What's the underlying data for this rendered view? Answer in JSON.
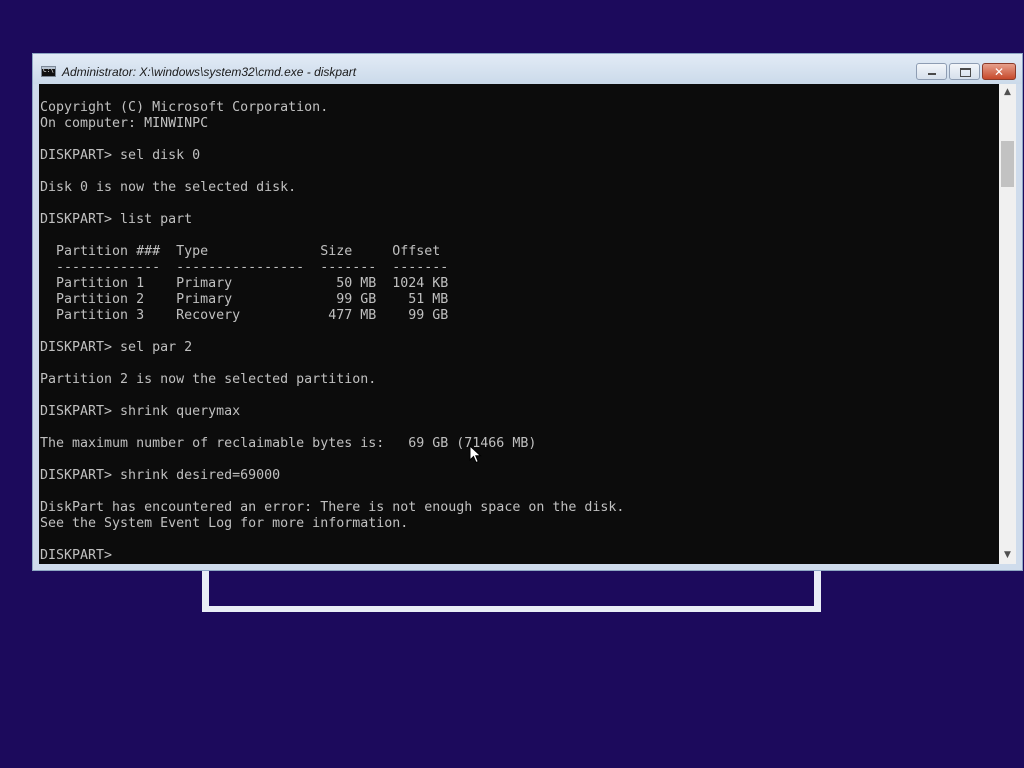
{
  "window": {
    "title": "Administrator: X:\\windows\\system32\\cmd.exe - diskpart",
    "icon": "cmd-icon",
    "icon_label": "C:\\",
    "controls": {
      "minimize": "minimize-icon",
      "maximize": "maximize-icon",
      "close": "close-icon",
      "close_glyph": "✕"
    }
  },
  "console": {
    "lines": [
      "Copyright (C) Microsoft Corporation.",
      "On computer: MINWINPC",
      "",
      "DISKPART> sel disk 0",
      "",
      "Disk 0 is now the selected disk.",
      "",
      "DISKPART> list part",
      "",
      "  Partition ###  Type              Size     Offset",
      "  -------------  ----------------  -------  -------",
      "  Partition 1    Primary             50 MB  1024 KB",
      "  Partition 2    Primary             99 GB    51 MB",
      "  Partition 3    Recovery           477 MB    99 GB",
      "",
      "DISKPART> sel par 2",
      "",
      "Partition 2 is now the selected partition.",
      "",
      "DISKPART> shrink querymax",
      "",
      "The maximum number of reclaimable bytes is:   69 GB (71466 MB)",
      "",
      "DISKPART> shrink desired=69000",
      "",
      "DiskPart has encountered an error: There is not enough space on the disk.",
      "See the System Event Log for more information.",
      "",
      "DISKPART> "
    ]
  },
  "scrollbar": {
    "up_arrow": "▲",
    "down_arrow": "▼"
  },
  "colors": {
    "desktop": "#1c0a5c",
    "console_bg": "#0c0c0c",
    "console_text": "#c0c0c0"
  }
}
